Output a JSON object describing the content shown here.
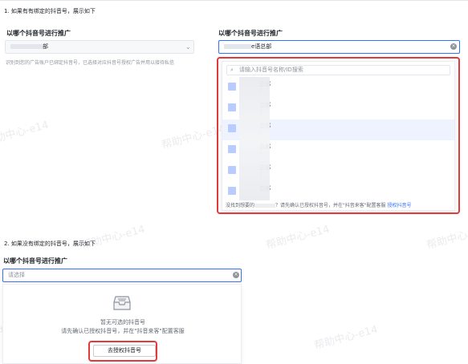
{
  "section1": {
    "title": "1. 如果有有绑定的抖音号，展示如下",
    "left_label": "以哪个抖音号进行推广",
    "left_value_suffix": "部",
    "left_hint": "识别到您的广告账户已绑定抖音号，已选择对应抖音号授权广告并用以接待私信",
    "right_label": "以哪个抖音号进行推广",
    "right_value_suffix": "e语总部",
    "search_placeholder": "请输入抖音号名称/ID搜索",
    "items": [
      {
        "name": "总部",
        "sub": "3",
        "active": false
      },
      {
        "name": "总部",
        "sub": "3",
        "active": false
      },
      {
        "name": "总部",
        "sub": "3",
        "active": true
      },
      {
        "name": "总部",
        "sub": "3",
        "active": false
      },
      {
        "name": "总部",
        "sub": "3",
        "active": false
      },
      {
        "name": "总部",
        "sub": "3",
        "active": false
      }
    ],
    "footer_prefix": "没找到想要的",
    "footer_middle": "？请先确认已授权抖音号，并在\"抖音来客\"配置客服",
    "footer_link": "授权抖音号"
  },
  "section2": {
    "title": "2. 如果没有绑定的抖音号，展示如下",
    "label": "以哪个抖音号进行推广",
    "placeholder": "请选择",
    "empty_title": "暂无可选的抖音号",
    "empty_desc": "请先确认已授权抖音号，并在\"抖音来客\"配置客服",
    "button_label": "去授权抖音号"
  },
  "watermark": "帮助中心-e14",
  "colors": {
    "accent": "#3370ff",
    "highlight_border": "#e03a3a",
    "text": "#1f2329",
    "muted": "#8f959e"
  }
}
